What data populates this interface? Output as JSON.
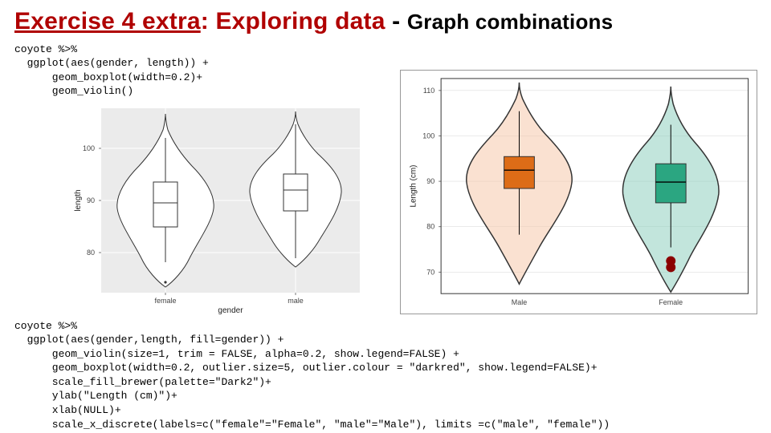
{
  "title": {
    "part1": "Exercise 4 extra",
    "part2": ": Exploring data ",
    "dash": "- ",
    "part3": "Graph combinations"
  },
  "code_top": "coyote %>%\n  ggplot(aes(gender, length)) +\n      geom_boxplot(width=0.2)+\n      geom_violin()",
  "code_bottom": "coyote %>%\n  ggplot(aes(gender,length, fill=gender)) +\n      geom_violin(size=1, trim = FALSE, alpha=0.2, show.legend=FALSE) +\n      geom_boxplot(width=0.2, outlier.size=5, outlier.colour = \"darkred\", show.legend=FALSE)+\n      scale_fill_brewer(palette=\"Dark2\")+\n      ylab(\"Length (cm)\")+\n      xlab(NULL)+\n      scale_x_discrete(labels=c(\"female\"=\"Female\", \"male\"=\"Male\"), limits =c(\"male\", \"female\"))",
  "chart_data": [
    {
      "type": "violin_box",
      "title": "",
      "xlabel": "gender",
      "ylabel": "length",
      "categories": [
        "female",
        "male"
      ],
      "ylim": [
        70,
        105
      ],
      "yticks": [
        80,
        90,
        100
      ],
      "series": [
        {
          "name": "female",
          "min": 71,
          "q1": 85,
          "median": 89.5,
          "q3": 93.5,
          "max": 102,
          "outliers": [
            71
          ]
        },
        {
          "name": "male",
          "min": 78,
          "q1": 88,
          "median": 92,
          "q3": 95,
          "max": 105,
          "outliers": []
        }
      ]
    },
    {
      "type": "violin_box",
      "title": "",
      "xlabel": "",
      "ylabel": "Length (cm)",
      "categories": [
        "Male",
        "Female"
      ],
      "ylim": [
        65,
        112
      ],
      "yticks": [
        70,
        80,
        90,
        100,
        110
      ],
      "series": [
        {
          "name": "Male",
          "min": 78,
          "q1": 88,
          "median": 92,
          "q3": 95,
          "max": 105,
          "outliers": []
        },
        {
          "name": "Female",
          "min": 71,
          "q1": 85,
          "median": 89.5,
          "q3": 93.5,
          "max": 102,
          "outliers": [
            71,
            72.5
          ]
        }
      ]
    }
  ],
  "left": {
    "xlabel": "gender",
    "ylabel": "length",
    "cat0": "female",
    "cat1": "male",
    "yt0": "80",
    "yt1": "90",
    "yt2": "100"
  },
  "right": {
    "ylabel": "Length (cm)",
    "cat0": "Male",
    "cat1": "Female",
    "yt0": "70",
    "yt1": "80",
    "yt2": "90",
    "yt3": "100",
    "yt4": "110"
  }
}
